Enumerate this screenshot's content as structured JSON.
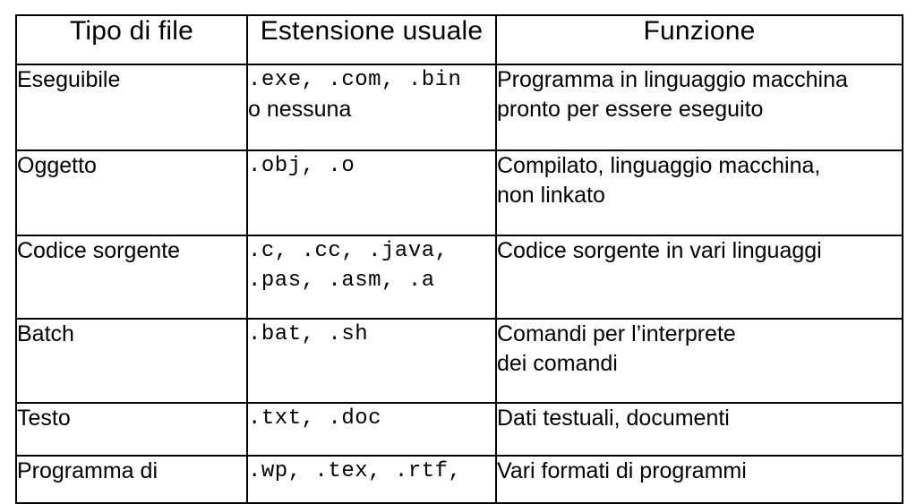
{
  "table": {
    "headers": [
      {
        "label": "Tipo di file"
      },
      {
        "label": "Estensione usuale"
      },
      {
        "label": "Funzione"
      }
    ],
    "header_background": "#dedede",
    "border_color": "#000000",
    "rows": [
      {
        "tipo": "Eseguibile",
        "estensione_mono": ".exe, .com, .bin",
        "estensione_sans": "o nessuna",
        "funzione_line1": "Programma in linguaggio macchina",
        "funzione_line2": "pronto per essere eseguito"
      },
      {
        "tipo": "Oggetto",
        "estensione_mono": ".obj, .o",
        "estensione_sans": "",
        "funzione_line1": "Compilato, linguaggio macchina,",
        "funzione_line2": "non linkato"
      },
      {
        "tipo": "Codice sorgente",
        "estensione_mono": ".c, .cc, .java,",
        "estensione_mono2": ".pas, .asm, .a",
        "estensione_sans": "",
        "funzione_line1": "Codice sorgente in vari linguaggi",
        "funzione_line2": ""
      },
      {
        "tipo": "Batch",
        "estensione_mono": ".bat, .sh",
        "estensione_sans": "",
        "funzione_line1": "Comandi per l’interprete",
        "funzione_line2": "dei comandi"
      },
      {
        "tipo": "Testo",
        "estensione_mono": ".txt, .doc",
        "estensione_sans": "",
        "funzione_line1": "Dati testuali, documenti",
        "funzione_line2": ""
      },
      {
        "tipo": "Programma di",
        "estensione_mono": ".wp, .tex, .rtf,",
        "estensione_sans": "",
        "funzione_line1": "Vari formati di programmi",
        "funzione_line2": ""
      }
    ]
  }
}
